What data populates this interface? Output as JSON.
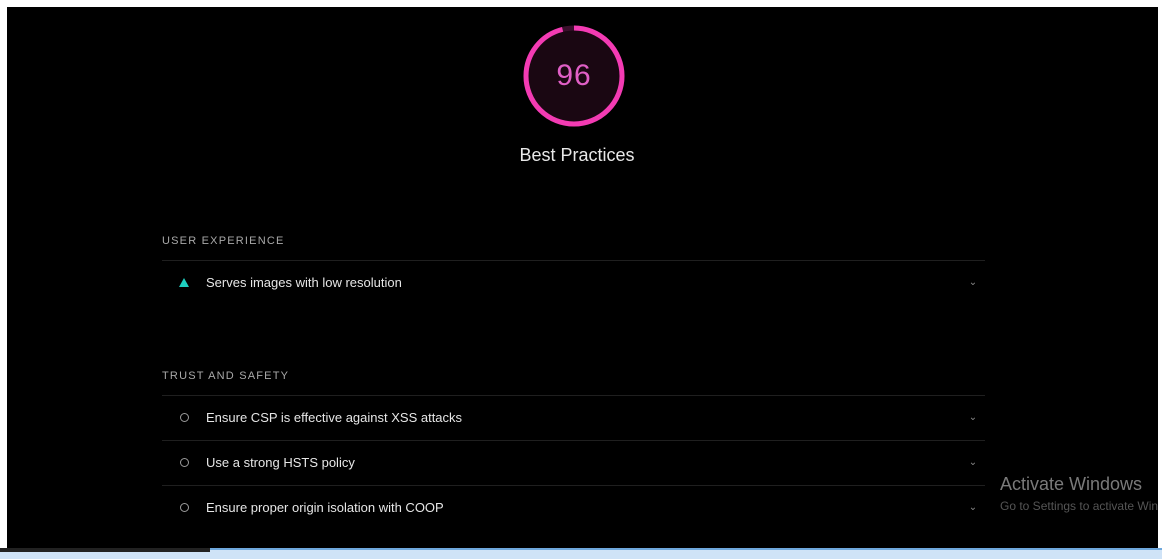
{
  "score": {
    "value": "96",
    "fraction": 0.96,
    "color": "#f33bb3",
    "title": "Best Practices"
  },
  "groups": [
    {
      "title": "USER EXPERIENCE",
      "audits": [
        {
          "label": "Serves images with low resolution",
          "status": "warning-triangle-icon"
        }
      ]
    },
    {
      "title": "TRUST AND SAFETY",
      "audits": [
        {
          "label": "Ensure CSP is effective against XSS attacks",
          "status": "info-circle-icon"
        },
        {
          "label": "Use a strong HSTS policy",
          "status": "info-circle-icon"
        },
        {
          "label": "Ensure proper origin isolation with COOP",
          "status": "info-circle-icon"
        }
      ]
    }
  ],
  "watermark": {
    "title": "Activate Windows",
    "subtitle": "Go to Settings to activate Windows."
  },
  "colors": {
    "warning": "#1ecfc0",
    "background": "#000000"
  }
}
